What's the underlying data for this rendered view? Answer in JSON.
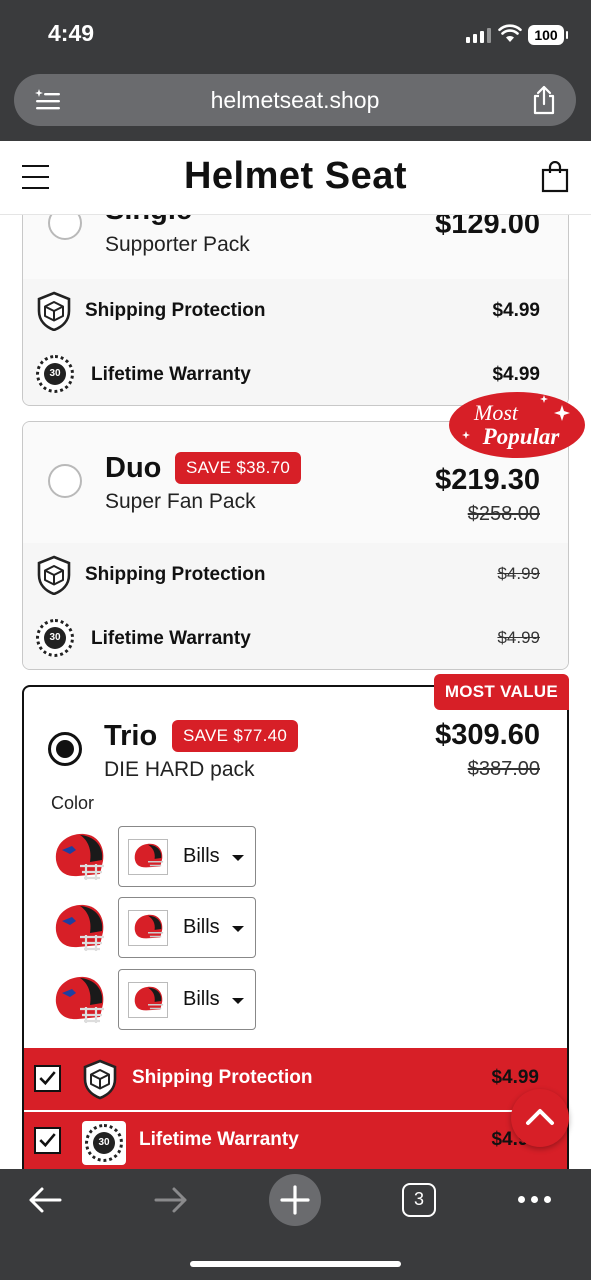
{
  "status_bar": {
    "time": "4:49",
    "battery": "100"
  },
  "browser": {
    "url": "helmetseat.shop",
    "tab_count": "3"
  },
  "header": {
    "title": "Helmet Seat"
  },
  "options": [
    {
      "name": "Single",
      "subtitle": "Supporter Pack",
      "price": "$129.00",
      "selected": false,
      "addons": [
        {
          "label": "Shipping Protection",
          "price": "$4.99",
          "struck": false
        },
        {
          "label": "Lifetime Warranty",
          "price": "$4.99",
          "struck": false
        }
      ]
    },
    {
      "name": "Duo",
      "save_badge": "SAVE $38.70",
      "subtitle": "Super Fan Pack",
      "price": "$219.30",
      "old_price": "$258.00",
      "selected": false,
      "ribbon": {
        "line1": "Most",
        "line2": "Popular"
      },
      "addons": [
        {
          "label": "Shipping Protection",
          "price": "$4.99",
          "struck": true
        },
        {
          "label": "Lifetime Warranty",
          "price": "$4.99",
          "struck": true
        }
      ]
    },
    {
      "name": "Trio",
      "save_badge": "SAVE $77.40",
      "subtitle": "DIE HARD pack",
      "price": "$309.60",
      "old_price": "$387.00",
      "selected": true,
      "tag": "MOST VALUE",
      "color_label": "Color",
      "colors": [
        {
          "value": "Bills"
        },
        {
          "value": "Bills"
        },
        {
          "value": "Bills"
        }
      ],
      "addons": [
        {
          "label": "Shipping Protection",
          "price": "$4.99",
          "checked": true
        },
        {
          "label": "Lifetime Warranty",
          "price": "$4.99",
          "checked": true
        }
      ]
    }
  ],
  "seal_text": "30",
  "colors": {
    "accent": "#d71f27",
    "chrome": "#3a3b3d"
  }
}
